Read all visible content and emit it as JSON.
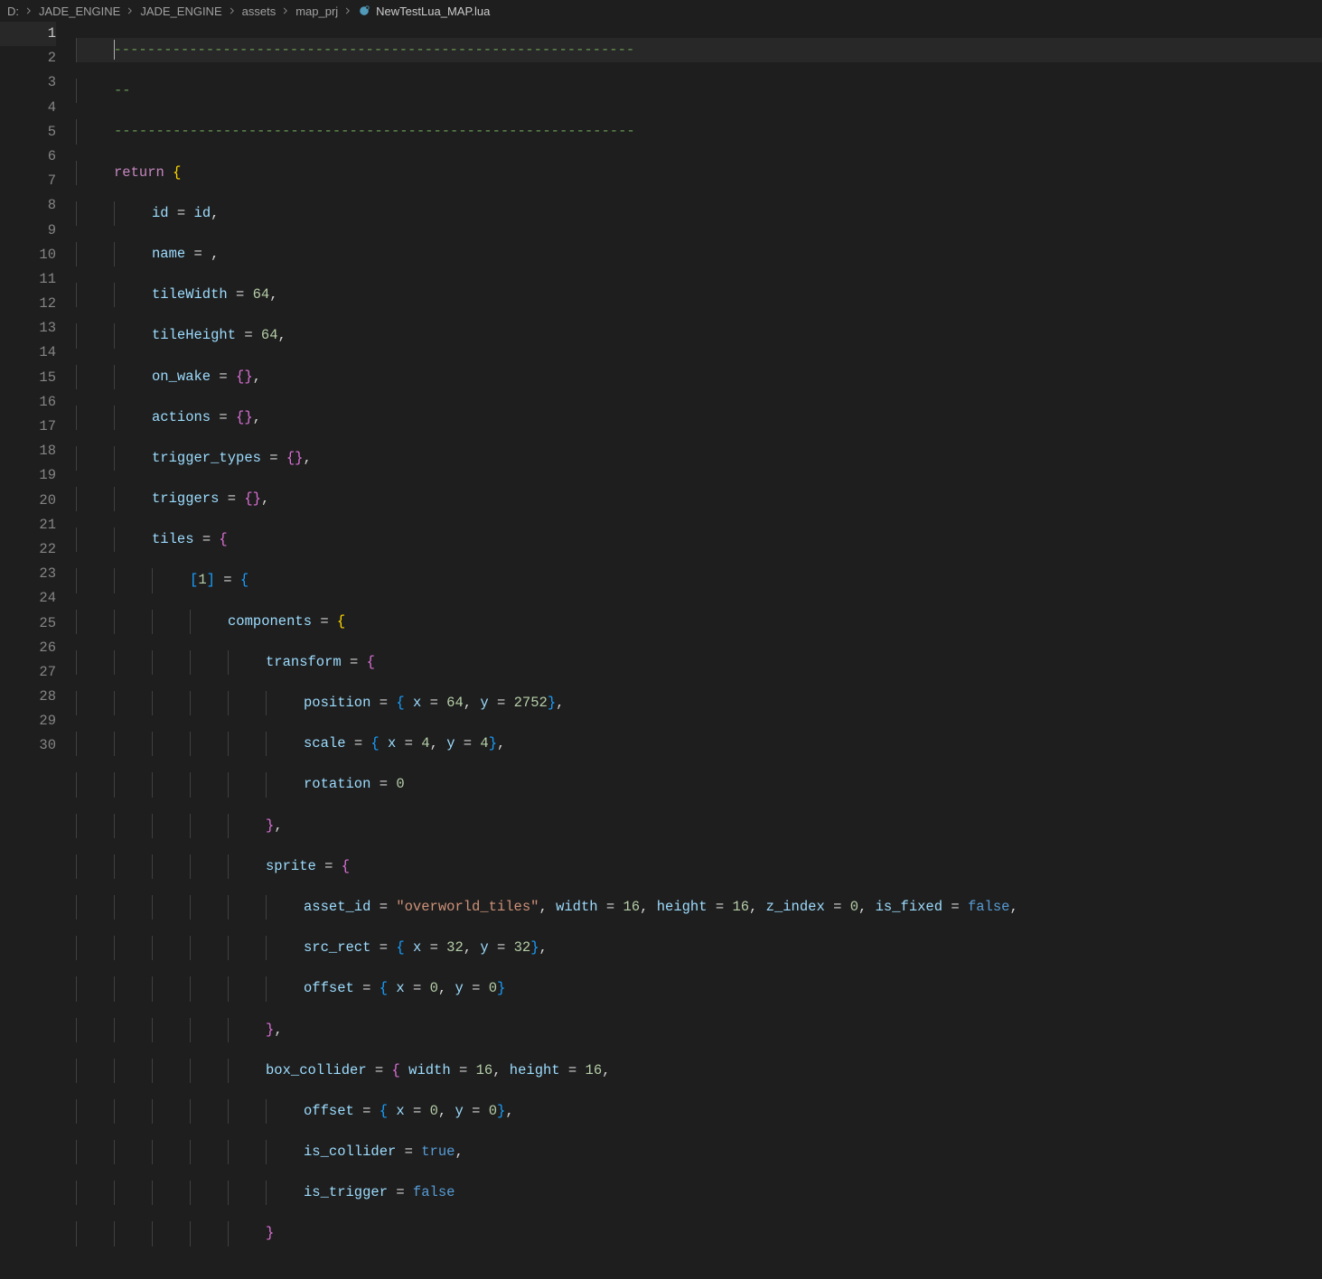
{
  "breadcrumb": {
    "drive": "D:",
    "segments": [
      "JADE_ENGINE",
      "JADE_ENGINE",
      "assets",
      "map_prj"
    ],
    "filename": "NewTestLua_MAP.lua"
  },
  "gutter": {
    "lines": [
      "1",
      "2",
      "3",
      "4",
      "5",
      "6",
      "7",
      "8",
      "9",
      "10",
      "11",
      "12",
      "13",
      "14",
      "15",
      "16",
      "17",
      "18",
      "19",
      "20",
      "21",
      "22",
      "23",
      "24",
      "25",
      "26",
      "27",
      "28",
      "29",
      "30"
    ]
  },
  "code": {
    "dash1": "--------------------------------------------------------------",
    "dash2": "--",
    "dash3": "--------------------------------------------------------------",
    "kw_return": "return",
    "id_lhs": "id",
    "id_rhs": "id",
    "name_lhs": "name",
    "tileWidth_lhs": "tileWidth",
    "tileWidth_val": "64",
    "tileHeight_lhs": "tileHeight",
    "tileHeight_val": "64",
    "on_wake_lhs": "on_wake",
    "actions_lhs": "actions",
    "trigger_types_lhs": "trigger_types",
    "triggers_lhs": "triggers",
    "tiles_lhs": "tiles",
    "idx1": "1",
    "components_lhs": "components",
    "transform_lhs": "transform",
    "position_lhs": "position",
    "x_lbl": "x",
    "y_lbl": "y",
    "pos_x": "64",
    "pos_y": "2752",
    "scale_lhs": "scale",
    "scale_x": "4",
    "scale_y": "4",
    "rotation_lhs": "rotation",
    "rotation_val": "0",
    "sprite_lhs": "sprite",
    "asset_id_lhs": "asset_id",
    "asset_id_val": "\"overworld_tiles\"",
    "width_lbl": "width",
    "sprite_w": "16",
    "height_lbl": "height",
    "sprite_h": "16",
    "z_index_lbl": "z_index",
    "z_index_val": "0",
    "is_fixed_lbl": "is_fixed",
    "is_fixed_val": "false",
    "src_rect_lhs": "src_rect",
    "src_x": "32",
    "src_y": "32",
    "offset_lhs": "offset",
    "off_x": "0",
    "off_y": "0",
    "box_collider_lhs": "box_collider",
    "bc_w": "16",
    "bc_h": "16",
    "bc_off_x": "0",
    "bc_off_y": "0",
    "is_collider_lhs": "is_collider",
    "is_collider_val": "true",
    "is_trigger_lhs": "is_trigger",
    "is_trigger_val": "false"
  }
}
